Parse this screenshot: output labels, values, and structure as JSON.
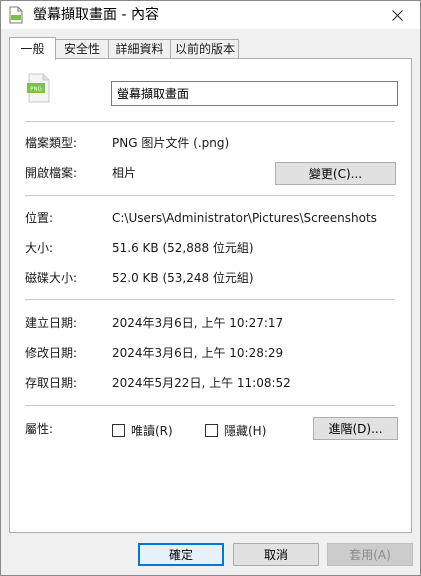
{
  "window": {
    "title": "螢幕擷取畫面 - 內容",
    "close_glyph": "✕"
  },
  "tabs": [
    {
      "label": "一般",
      "active": true
    },
    {
      "label": "安全性",
      "active": false
    },
    {
      "label": "詳細資料",
      "active": false
    },
    {
      "label": "以前的版本",
      "active": false
    }
  ],
  "file": {
    "icon_text": "PNG",
    "name_value": "螢幕擷取畫面",
    "type_label": "檔案類型:",
    "type_value": "PNG 图片文件 (.png)",
    "opens_with_label": "開啟檔案:",
    "opens_with_value": "相片",
    "change_button": "變更(C)..."
  },
  "location": {
    "location_label": "位置:",
    "location_value": "C:\\Users\\Administrator\\Pictures\\Screenshots",
    "size_label": "大小:",
    "size_value": "51.6 KB (52,888 位元組)",
    "size_on_disk_label": "磁碟大小:",
    "size_on_disk_value": "52.0 KB (53,248 位元組)"
  },
  "dates": {
    "created_label": "建立日期:",
    "created_value": "2024年3月6日, 上午 10:27:17",
    "modified_label": "修改日期:",
    "modified_value": "2024年3月6日, 上午 10:28:29",
    "accessed_label": "存取日期:",
    "accessed_value": "2024年5月22日, 上午 11:08:52"
  },
  "attributes": {
    "label": "屬性:",
    "readonly_label": "唯讀(R)",
    "readonly_checked": false,
    "hidden_label": "隱藏(H)",
    "hidden_checked": false,
    "advanced_button": "進階(D)..."
  },
  "footer": {
    "ok": "確定",
    "cancel": "取消",
    "apply": "套用(A)"
  },
  "colors": {
    "accent": "#0078d7",
    "png_icon_green": "#7cc243"
  }
}
